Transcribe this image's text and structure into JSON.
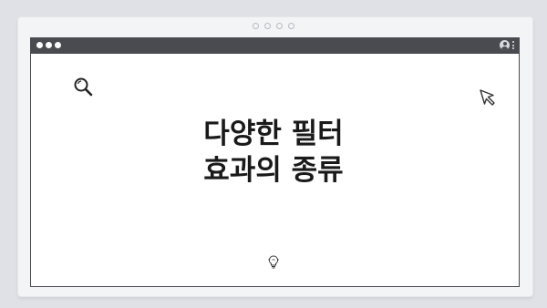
{
  "slide": {
    "title_line1": "다양한 필터",
    "title_line2": "효과의 종류"
  },
  "icons": {
    "search": "search-icon",
    "cursor": "cursor-icon",
    "lightbulb": "lightbulb-icon",
    "user": "user-icon",
    "menu": "kebab-menu-icon"
  },
  "colors": {
    "background": "#dfe1e7",
    "frame": "#f3f4f6",
    "titlebar": "#4a4b50",
    "window": "#ffffff",
    "title_text": "#1a1a1a"
  }
}
